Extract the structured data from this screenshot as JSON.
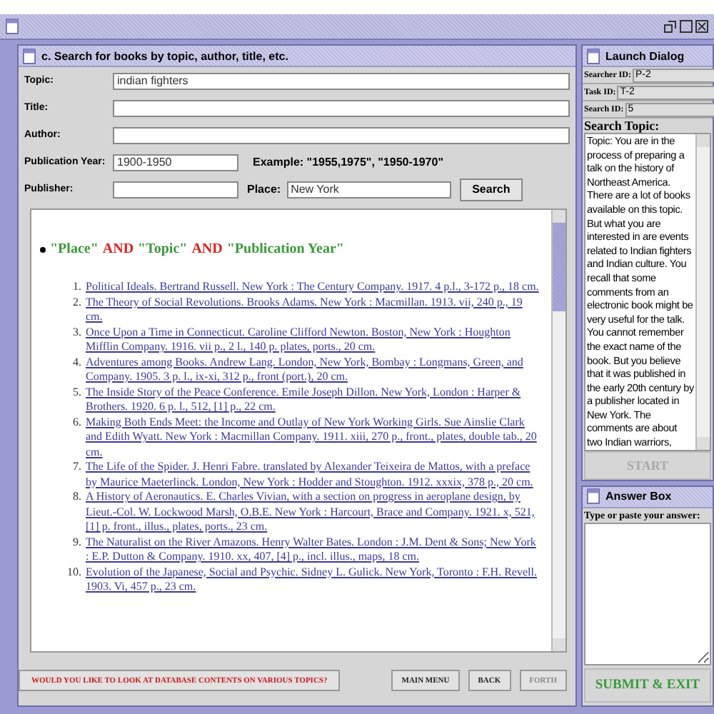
{
  "search_window": {
    "title": "c. Search for books by topic, author, title, etc.",
    "fields": [
      {
        "label": "Topic:",
        "value": "indian fighters"
      },
      {
        "label": "Title:"
      },
      {
        "label": "Author:"
      }
    ],
    "year": {
      "label": "Publication Year:",
      "value": "1900-1950",
      "example": "Example: \"1955,1975\", \"1950-1970\""
    },
    "publisher": {
      "label": "Publisher:"
    },
    "place": {
      "label": "Place:",
      "value": "New York"
    },
    "search_button": "Search",
    "results": {
      "heading": [
        {
          "text": "\"Place\"",
          "kind": "term"
        },
        {
          "text": "AND",
          "kind": "operator"
        },
        {
          "text": "\"Topic\"",
          "kind": "term"
        },
        {
          "text": "AND",
          "kind": "operator"
        },
        {
          "text": "\"Publication Year\"",
          "kind": "term"
        }
      ],
      "items": [
        {
          "number": "1.",
          "text": "Political Ideals. Bertrand Russell. New York : The Century Company. 1917. 4 p.l., 3-172 p., 18 cm."
        },
        {
          "number": "2.",
          "text": "The Theory of Social Revolutions. Brooks Adams. New York : Macmillan. 1913. vii, 240 p., 19 cm."
        },
        {
          "number": "3.",
          "text": "Once Upon a Time in Connecticut. Caroline Clifford Newton. Boston, New York : Houghton Mifflin Company. 1916. vii p., 2 l., 140 p. plates, ports., 20 cm."
        },
        {
          "number": "4.",
          "text": "Adventures among Books. Andrew Lang. London, New York, Bombay : Longmans, Green, and Company. 1905. 3 p. l., ix-xi, 312 p., front (port.), 20 cm."
        },
        {
          "number": "5.",
          "text": "The Inside Story of the Peace Conference. Emile Joseph Dillon. New York, London : Harper & Brothers. 1920. 6 p. l., 512, [1] p., 22 cm."
        },
        {
          "number": "6.",
          "text": "Making Both Ends Meet: the Income and Outlay of New York Working Girls. Sue Ainslie Clark and Edith Wyatt. New York : Macmillan Company. 1911. xiii, 270 p., front., plates, double tab., 20 cm."
        },
        {
          "number": "7.",
          "text": "The Life of the Spider. J. Henri Fabre. translated by Alexander Teixeira de Mattos, with a preface by Maurice Maeterlinck. London, New York : Hodder and Stoughton. 1912. xxxix, 378 p., 20 cm."
        },
        {
          "number": "8.",
          "text": "A History of Aeronautics. E. Charles Vivian, with a section on progress in aeroplane design, by Lieut.-Col. W. Lockwood Marsh, O.B.E. New York : Harcourt, Brace and Company. 1921. x, 521, [1] p. front., illus., plates, ports., 23 cm."
        },
        {
          "number": "9.",
          "text": "The Naturalist on the River Amazons. Henry Walter Bates. London : J.M. Dent & Sons; New York : E.P. Dutton & Company. 1910. xx, 407, [4] p., incl. illus., maps, 18 cm."
        },
        {
          "number": "10.",
          "text": "Evolution of the Japanese, Social and Psychic. Sidney L. Gulick. New York, Toronto : F.H. Revell. 1903. Vi, 457 p., 23 cm."
        }
      ]
    },
    "bottom_buttons": [
      {
        "label": "WOULD YOU LIKE TO LOOK AT DATABASE CONTENTS ON VARIOUS TOPICS?",
        "kind": "prompt",
        "disabled": false
      },
      {
        "label": "MAIN MENU",
        "kind": "nav",
        "disabled": false
      },
      {
        "label": "BACK",
        "kind": "nav",
        "disabled": false
      },
      {
        "label": "FORTH",
        "kind": "nav",
        "disabled": true
      }
    ]
  },
  "launch_dialog": {
    "title": "Launch Dialog",
    "ids": [
      {
        "label": "Searcher ID:",
        "value": "P-2"
      },
      {
        "label": "Task ID:",
        "value": "T-2"
      },
      {
        "label": "Search ID:",
        "value": "5"
      }
    ],
    "topic_heading": "Search Topic:",
    "topic_text": "Topic: You are in the process of preparing a talk on the history of Northeast America. There are a lot of books available on this topic. But what you are interested in are events related to Indian fighters and Indian culture.  You recall that some comments from an electronic book might be very useful for the talk. You cannot remember the exact name of the book. But you believe that it was published in the early 20th century by a publisher located in New York. The comments are about two Indian warriors,",
    "start_button": {
      "label": "START",
      "disabled": true
    }
  },
  "answer_box": {
    "title": "Answer Box",
    "prompt": "Type or paste your answer:",
    "submit_button": "SUBMIT & EXIT"
  }
}
